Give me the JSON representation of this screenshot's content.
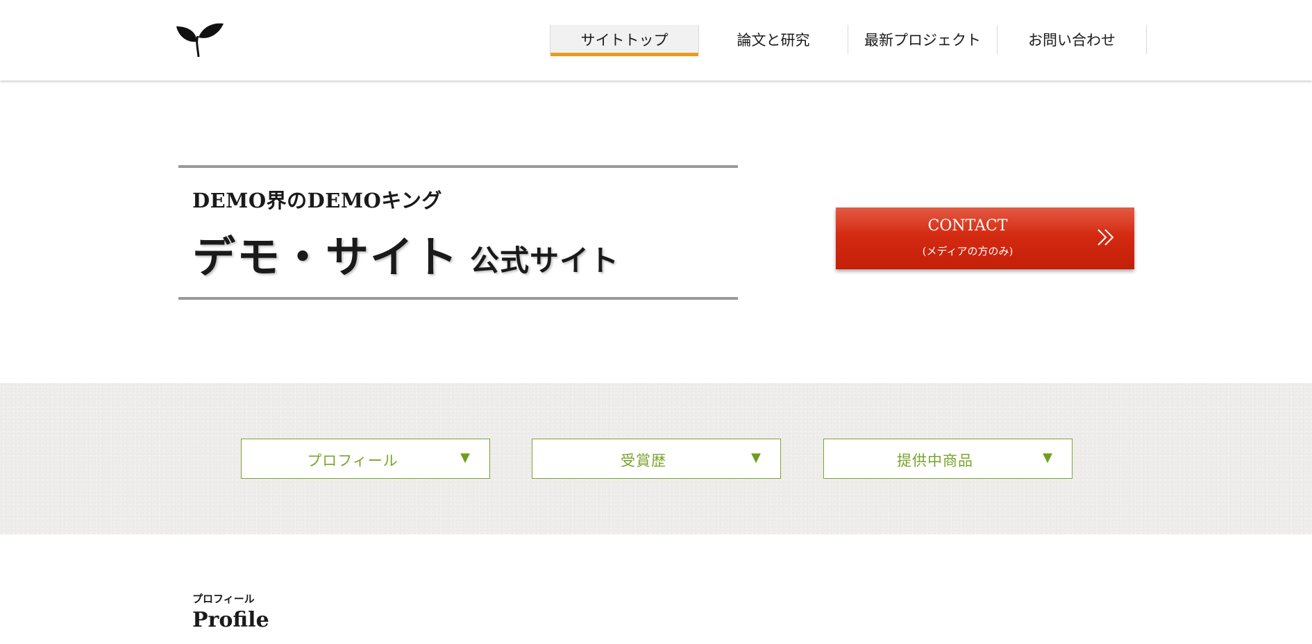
{
  "header": {
    "logo_icon": "leaf-sprout-icon",
    "nav": [
      {
        "label": "サイトトップ",
        "active": true
      },
      {
        "label": "論文と研究",
        "active": false
      },
      {
        "label": "最新プロジェクト",
        "active": false
      },
      {
        "label": "お問い合わせ",
        "active": false
      }
    ],
    "accent_color": "#e99c1c"
  },
  "hero": {
    "subtitle": "DEMO界のDEMOキング",
    "title": "デモ・サイト",
    "title_suffix": "公式サイト"
  },
  "contact": {
    "label": "CONTACT",
    "sublabel": "(メディアの方のみ)",
    "arrow_icon": "double-chevron-right-icon",
    "color": "#d42a12"
  },
  "menu": {
    "items": [
      {
        "label": "プロフィール",
        "icon": "triangle-down-icon"
      },
      {
        "label": "受賞歴",
        "icon": "triangle-down-icon"
      },
      {
        "label": "提供中商品",
        "icon": "triangle-down-icon"
      }
    ],
    "color": "#7aa32a"
  },
  "profile": {
    "heading_jp": "プロフィール",
    "heading_en": "Profile"
  }
}
